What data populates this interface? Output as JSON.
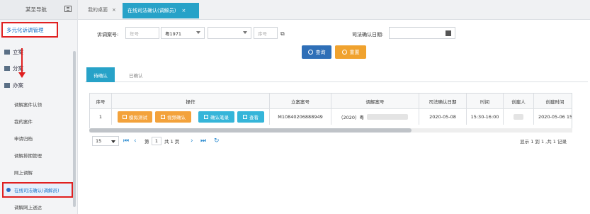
{
  "sidebar": {
    "title": "某圣导航",
    "top_item": "多元化诉调管理",
    "groups": [
      "立案",
      "分案",
      "办案"
    ],
    "sub_items": [
      "调解案件认领",
      "我的案件",
      "申请归档",
      "调解排期管理",
      "网上调解"
    ],
    "active_item": "在线司法确认(调解员)",
    "last_item": "调解网上送达"
  },
  "tabs": {
    "home": "我的桌面",
    "active": "在线司法确认(调解员)",
    "close": "×"
  },
  "search": {
    "case_no_label": "诉调案号:",
    "year_placeholder": "年号",
    "court_value": "粤1971",
    "court_select_value": "",
    "seq_placeholder": "序号",
    "date_label": "司法确认日期:",
    "date_value": "",
    "query_label": "查询",
    "reset_label": "重置"
  },
  "colors": {
    "primary": "#27a2c8",
    "query": "#2f6fb7",
    "reset": "#f0a22e",
    "action_orange": "#f3a23b",
    "action_cyan": "#35b5d9",
    "highlight_red": "#e02020"
  },
  "inner_tabs": {
    "pending": "待确认",
    "confirmed": "已确认"
  },
  "table": {
    "headers": [
      "序号",
      "操作",
      "立案案号",
      "调解案号",
      "司法确认日期",
      "时间",
      "创建人",
      "创建时间"
    ],
    "row": {
      "index": "1",
      "actions": [
        "模拟测试",
        "视频确认",
        "确认笔录",
        "查看"
      ],
      "filing_no": "M10840206888949",
      "mediation_no_prefix": "（2020）粤",
      "date": "2020-05-08",
      "time": "15:30-16:00",
      "creator": "",
      "created_at": "2020-05-06 15"
    }
  },
  "pager": {
    "page_size": "15",
    "page_prefix": "第",
    "page_value": "1",
    "page_suffix": "共 1 页",
    "info": "显示 1 到 1 ,共 1 记录"
  },
  "icons": [
    "menu-icon",
    "calendar-icon",
    "search-icon",
    "refresh-icon",
    "arrow-down-icon",
    "first-page-icon",
    "prev-page-icon",
    "next-page-icon",
    "last-page-icon",
    "reload-icon"
  ]
}
